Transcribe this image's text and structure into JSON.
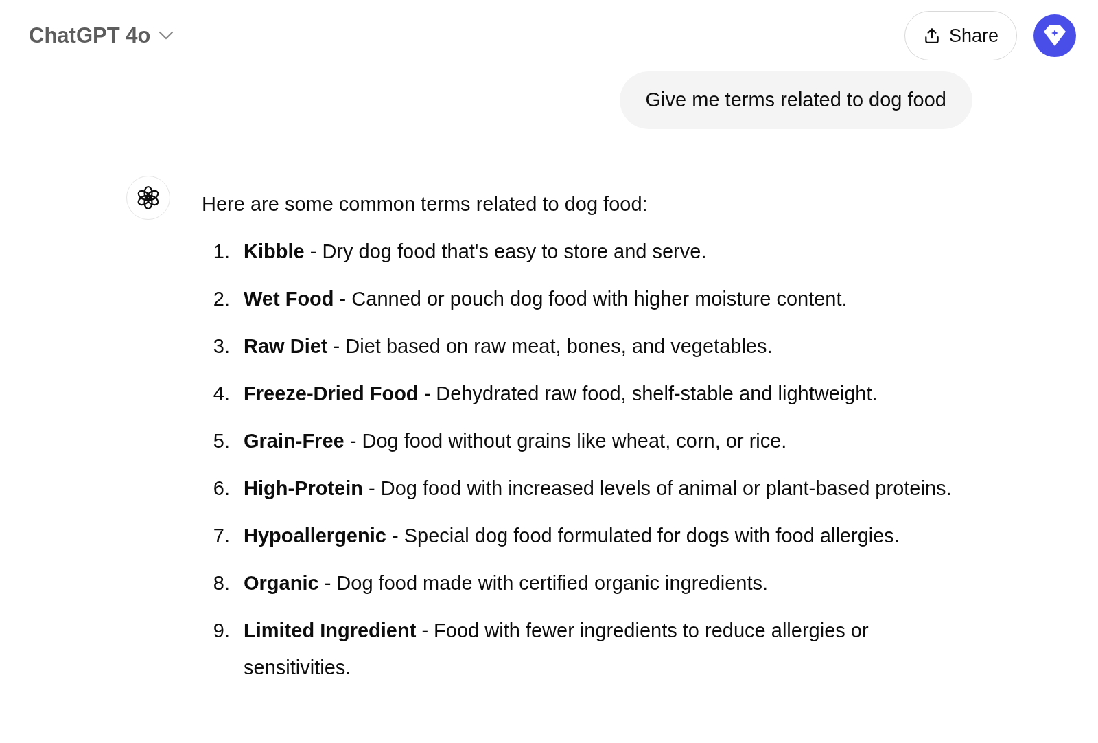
{
  "header": {
    "model": "ChatGPT 4o",
    "share": "Share"
  },
  "user_message": "Give me terms related to dog food",
  "assistant": {
    "intro": "Here are some common terms related to dog food:",
    "items": [
      {
        "number": "1.",
        "text": "**Kibble** - Dry dog food that's easy to store and serve."
      },
      {
        "number": "2.",
        "text": "**Wet Food** - Canned or pouch dog food with higher moisture content."
      },
      {
        "number": "3.",
        "text": "**Raw Diet** - Diet based on raw meat, bones, and vegetables."
      },
      {
        "number": "4.",
        "text": "**Freeze-Dried Food** - Dehydrated raw food, shelf-stable and lightweight."
      },
      {
        "number": "5.",
        "text": "**Grain-Free** - Dog food without grains like wheat, corn, or rice."
      },
      {
        "number": "6.",
        "text": "**High-Protein** - Dog food with increased levels of animal or plant-based proteins."
      },
      {
        "number": "7.",
        "text": "**Hypoallergenic** - Special dog food formulated for dogs with food allergies."
      },
      {
        "number": "8.",
        "text": "**Organic** - Dog food made with certified organic ingredients."
      },
      {
        "number": "9.",
        "text": "**Limited Ingredient** - Food with fewer ingredients to reduce allergies or sensitivities."
      }
    ]
  }
}
